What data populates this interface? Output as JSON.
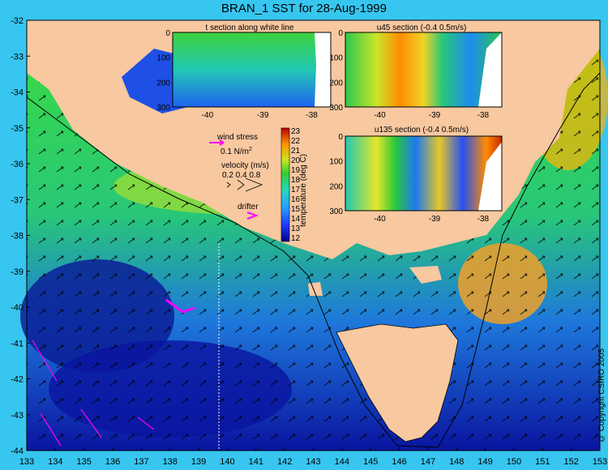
{
  "title": "BRAN_1 SST for 28-Aug-1999",
  "copyright": "© Copyright CSIRO 2005",
  "map": {
    "x_ticks": [
      "133",
      "134",
      "135",
      "136",
      "137",
      "138",
      "139",
      "140",
      "141",
      "142",
      "143",
      "144",
      "145",
      "146",
      "147",
      "148",
      "149",
      "150",
      "151",
      "152",
      "153"
    ],
    "y_ticks": [
      "-32",
      "-33",
      "-34",
      "-35",
      "-36",
      "-37",
      "-38",
      "-39",
      "-40",
      "-41",
      "-42",
      "-43",
      "-44"
    ]
  },
  "insets": {
    "t_section": {
      "title": "t section along white line",
      "x_ticks": [
        "-40",
        "-39",
        "-38"
      ],
      "y_ticks": [
        "0",
        "100",
        "200",
        "300"
      ]
    },
    "u45_section": {
      "title": "u45 section (-0.4      0.5m/s)",
      "x_ticks": [
        "-40",
        "-39",
        "-38"
      ],
      "y_ticks": [
        "0",
        "100",
        "200",
        "300"
      ]
    },
    "u135_section": {
      "title": "u135 section (-0.4      0.5m/s)",
      "x_ticks": [
        "-40",
        "-39",
        "-38"
      ],
      "y_ticks": [
        "0",
        "100",
        "200",
        "300"
      ]
    }
  },
  "legend": {
    "wind_stress_label": "wind stress",
    "wind_stress_value": "0.1 N/m",
    "wind_stress_sup": "2",
    "velocity_label": "velocity (m/s)",
    "velocity_values": "0.2 0.4 0.8",
    "drifter_label": "drifter"
  },
  "colorbar": {
    "label": "temperature (deg C)",
    "ticks": [
      "23",
      "22",
      "21",
      "20",
      "19",
      "18",
      "17",
      "16",
      "15",
      "14",
      "13",
      "12"
    ]
  },
  "colors": {
    "background": "#37c6f0",
    "land": "#f8c8a0",
    "drifter": "#ff00ff"
  }
}
